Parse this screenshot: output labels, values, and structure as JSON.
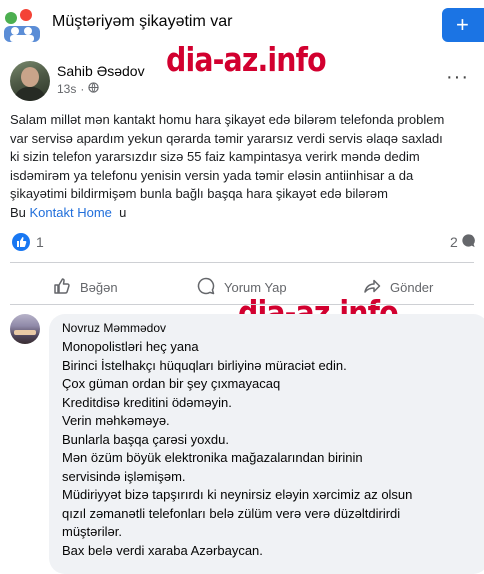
{
  "group": {
    "title": "Müştəriyəm şikayətim var",
    "create_label": "+"
  },
  "watermark": "dia-az.info",
  "post": {
    "author": "Sahib Əsədov",
    "time": "13s",
    "more_label": "···",
    "lines": [
      "Salam millət mən kantakt homu hara şikayət edə bilərəm telefonda problem",
      "var servisə apardım yekun qərarda təmir yararsız verdi servis əlaqə saxladı",
      "ki sizin telefon yararsızdır sizə 55 faiz kampintasya verirk məndə dedim",
      "isdəmirəm ya telefonu yenisin versin yada təmir eləsin antiinhisar a da",
      "şikayətimi bildirmişəm bunla bağlı başqa hara şikayət edə bilərəm"
    ],
    "last_line": {
      "prefix": "Bu ",
      "link": "Kontakt Home",
      "suffix": "  u"
    },
    "reactions_count": "1",
    "comments_count": "2"
  },
  "actions": {
    "like": "Bəğən",
    "comment": "Yorum Yap",
    "share": "Gönder"
  },
  "comment": {
    "author": "Novruz Məmmədov",
    "lines": [
      "Monopolistləri heç yana",
      "Birinci İstelhakçı hüquqları birliyinə müraciət edin.",
      "Çox güman ordan bir şey çıxmayacaq",
      "Kreditdisə kreditini ödəməyin.",
      "Verin məhkəməyə.",
      "Bunlarla başqa çarəsi yoxdu.",
      "Mən özüm böyük elektronika mağazalarından birinin",
      "servisində işləmişəm.",
      "Müdiriyyət bizə tapşırırdı ki neynirsiz eləyin xərcimiz az olsun",
      "qızıl zəmanətli telefonları belə zülüm verə verə düzəltdirirdi",
      "müştərilər.",
      "Bax belə verdi xaraba Azərbaycan."
    ]
  }
}
